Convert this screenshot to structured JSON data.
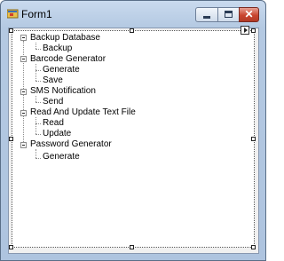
{
  "window": {
    "title": "Form1",
    "icon": "form-app-icon",
    "controls": [
      "minimize-icon",
      "maximize-icon",
      "close-icon"
    ],
    "close_glyph": "✕"
  },
  "tree": {
    "smart_tag_icon": "smart-tag-arrow-icon",
    "nodes": [
      {
        "label": "Backup Database",
        "expanded": true,
        "children": [
          {
            "label": "Backup"
          }
        ]
      },
      {
        "label": "Barcode Generator",
        "expanded": true,
        "children": [
          {
            "label": "Generate"
          },
          {
            "label": "Save"
          }
        ]
      },
      {
        "label": "SMS Notification",
        "expanded": true,
        "children": [
          {
            "label": "Send"
          }
        ]
      },
      {
        "label": "Read And Update Text File",
        "expanded": true,
        "children": [
          {
            "label": "Read"
          },
          {
            "label": "Update"
          }
        ]
      },
      {
        "label": "Password Generator",
        "expanded": true,
        "children": [
          {
            "label": "Generate"
          }
        ]
      }
    ]
  },
  "colors": {
    "title_gradient_top": "#c9daee",
    "close_button": "#c9442f",
    "tree_background": "#ffffff"
  }
}
